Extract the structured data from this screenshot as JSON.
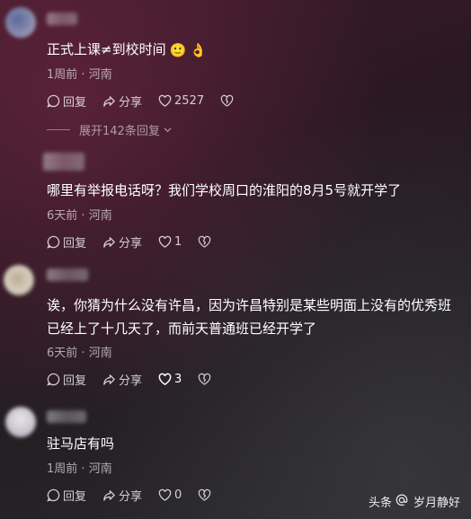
{
  "comments": [
    {
      "text": "正式上课≠到校时间",
      "emojis": [
        "🙂",
        "👌"
      ],
      "time": "1周前",
      "location": "河南",
      "reply_label": "回复",
      "share_label": "分享",
      "likes": "2527",
      "expand_label": "展开142条回复"
    },
    {
      "text": "哪里有举报电话呀？我们学校周口的淮阳的8月5号就开学了",
      "time": "6天前",
      "location": "河南",
      "reply_label": "回复",
      "share_label": "分享",
      "likes": "1"
    },
    {
      "text": "诶，你猜为什么没有许昌，因为许昌特别是某些明面上没有的优秀班已经上了十几天了，而前天普通班已经开学了",
      "time": "6天前",
      "location": "河南",
      "reply_label": "回复",
      "share_label": "分享",
      "likes": "3"
    },
    {
      "text": "驻马店有吗",
      "time": "1周前",
      "location": "河南",
      "reply_label": "回复",
      "share_label": "分享",
      "likes": "0"
    }
  ],
  "meta_separator": "·",
  "watermark": {
    "source": "头条",
    "author": "岁月静好"
  },
  "colors": {
    "text": "#ffffff",
    "meta": "#a39aa0",
    "background_top": "#3e1b2c",
    "background_bottom": "#2b2b2e"
  }
}
